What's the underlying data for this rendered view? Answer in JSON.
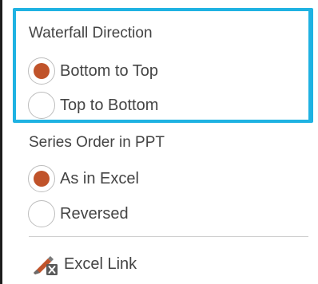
{
  "waterfall_direction": {
    "title": "Waterfall Direction",
    "options": [
      {
        "label": "Bottom to Top",
        "selected": true
      },
      {
        "label": "Top to Bottom",
        "selected": false
      }
    ]
  },
  "series_order": {
    "title": "Series Order in PPT",
    "options": [
      {
        "label": "As in Excel",
        "selected": true
      },
      {
        "label": "Reversed",
        "selected": false
      }
    ]
  },
  "excel_link": {
    "label": "Excel Link",
    "icon": "excel-link-icon"
  },
  "colors": {
    "focus_border": "#1fb2e2",
    "radio_selected": "#c0532a",
    "text": "#444444"
  }
}
